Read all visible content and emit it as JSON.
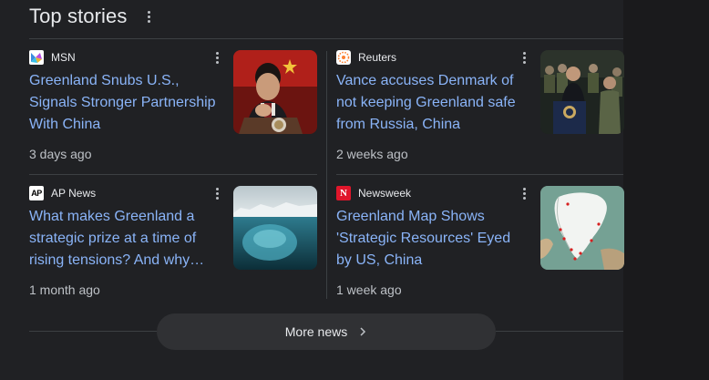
{
  "section": {
    "title": "Top stories"
  },
  "stories": [
    {
      "source": "MSN",
      "headline": "Greenland Snubs U.S., Signals Stronger Partnership With China",
      "time": "3 days ago"
    },
    {
      "source": "Reuters",
      "headline": "Vance accuses Denmark of not keeping Greenland safe from Russia, China",
      "time": "2 weeks ago"
    },
    {
      "source": "AP News",
      "headline": "What makes Greenland a strategic prize at a time of rising tensions? And why…",
      "time": "1 month ago"
    },
    {
      "source": "Newsweek",
      "headline": "Greenland Map Shows 'Strategic Resources' Eyed by US, China",
      "time": "1 week ago"
    }
  ],
  "more_button": {
    "label": "More news"
  },
  "icons": {
    "section_menu": "more-vert-icon",
    "card_menu": "more-vert-icon",
    "more_chevron": "chevron-right-icon"
  },
  "colors": {
    "background": "#202124",
    "link": "#8ab4f8",
    "text": "#e8eaed",
    "muted": "#bdc1c6",
    "divider": "#3c4043",
    "button": "#303134"
  }
}
